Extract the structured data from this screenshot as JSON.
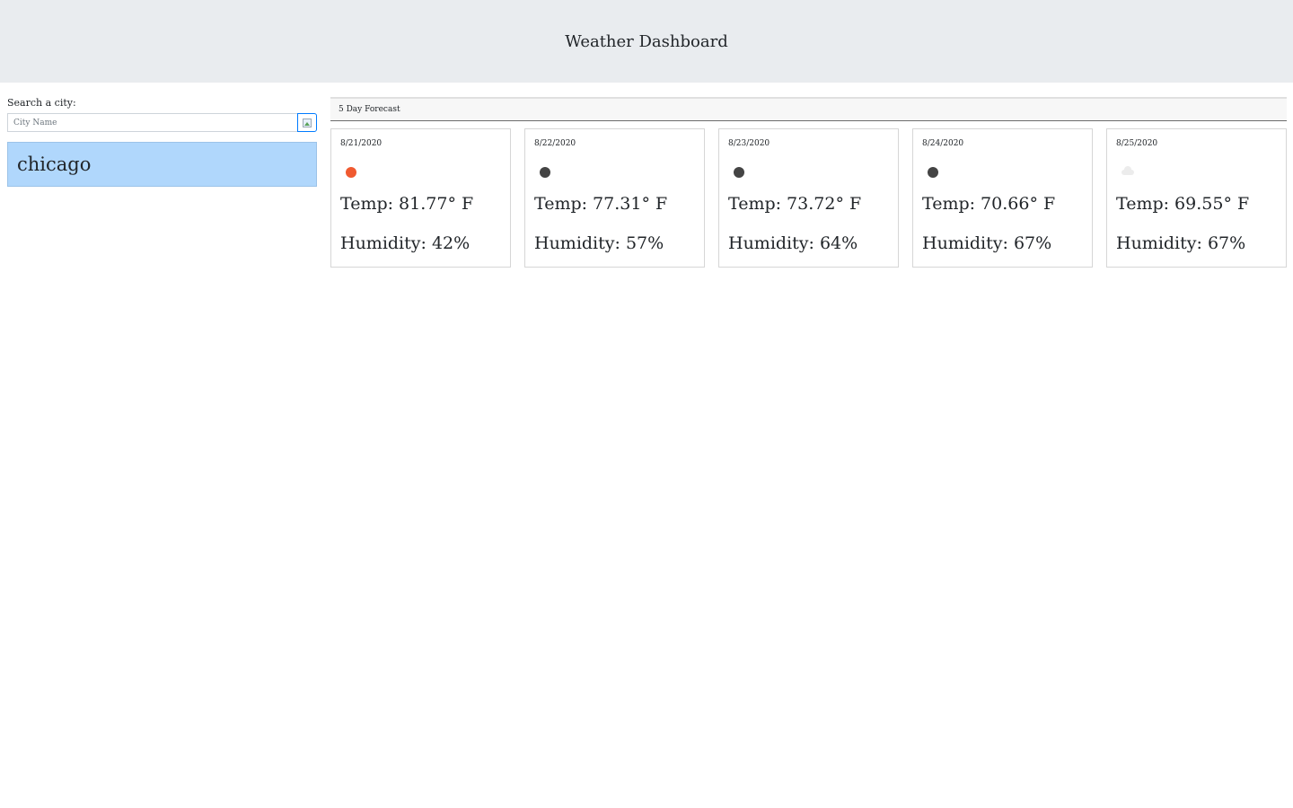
{
  "header": {
    "title": "Weather Dashboard"
  },
  "sidebar": {
    "search_label": "Search a city:",
    "search_placeholder": "City Name",
    "search_value": "",
    "history": [
      {
        "city": "chicago"
      }
    ]
  },
  "forecast": {
    "heading": "5 Day Forecast",
    "days": [
      {
        "date": "8/21/2020",
        "icon": "sun-icon",
        "temp": "Temp: 81.77° F",
        "humidity": "Humidity: 42%"
      },
      {
        "date": "8/22/2020",
        "icon": "moon-icon",
        "temp": "Temp: 77.31° F",
        "humidity": "Humidity: 57%"
      },
      {
        "date": "8/23/2020",
        "icon": "moon-icon",
        "temp": "Temp: 73.72° F",
        "humidity": "Humidity: 64%"
      },
      {
        "date": "8/24/2020",
        "icon": "moon-icon",
        "temp": "Temp: 70.66° F",
        "humidity": "Humidity: 67%"
      },
      {
        "date": "8/25/2020",
        "icon": "cloud-icon",
        "temp": "Temp: 69.55° F",
        "humidity": "Humidity: 67%"
      }
    ]
  },
  "colors": {
    "header_bg": "#e9ecef",
    "history_bg": "#b0d7fc",
    "sun": "#f05a30",
    "moon": "#444444",
    "button_border": "#007bff"
  }
}
